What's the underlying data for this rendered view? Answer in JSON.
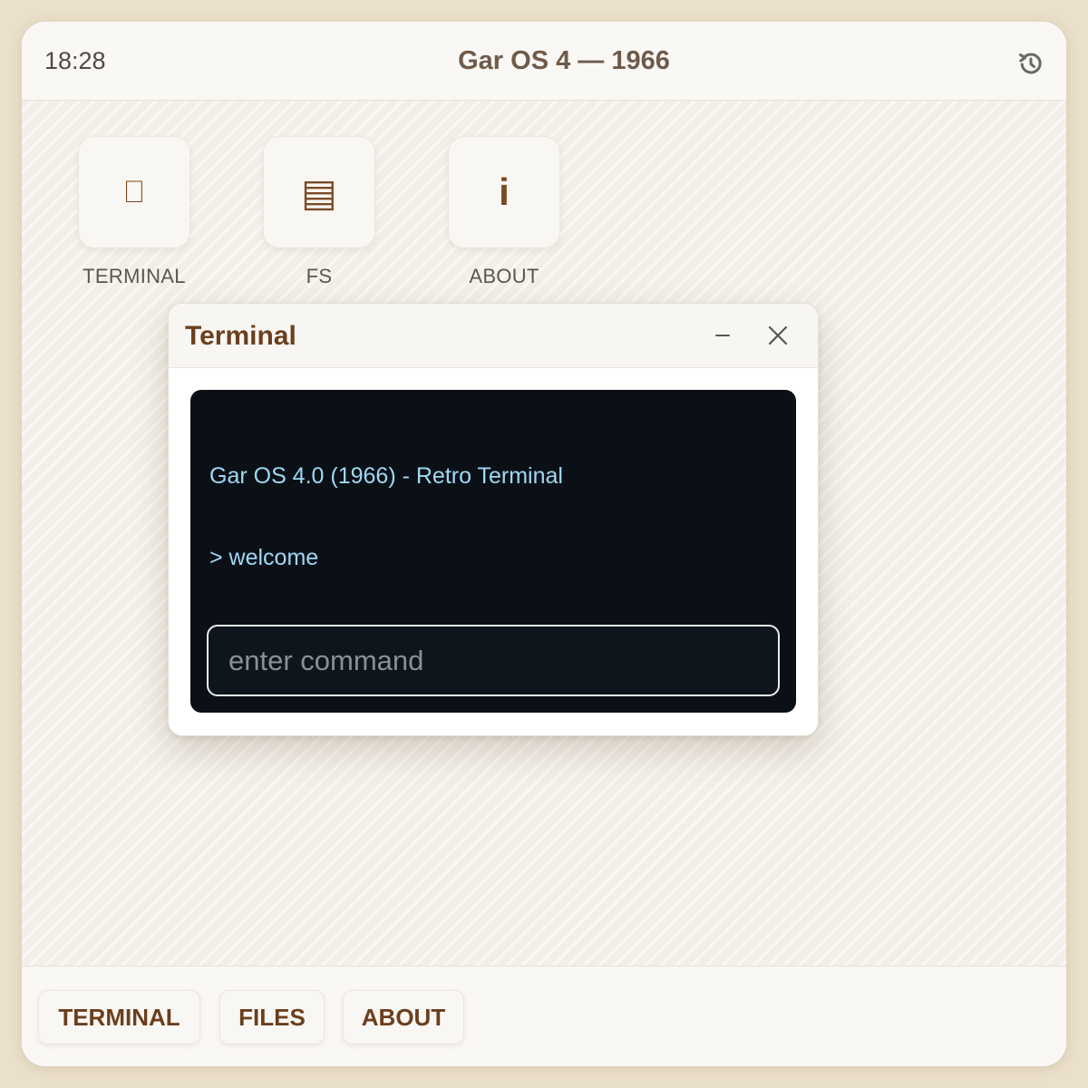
{
  "topbar": {
    "time": "18:28",
    "title": "Gar OS 4 — 1966",
    "restart_icon": "restart-icon"
  },
  "desktop_icons": [
    {
      "glyph": "⎕",
      "icon": "terminal-icon",
      "label": "TERMINAL"
    },
    {
      "glyph": "▤",
      "icon": "folder-icon",
      "label": "FS"
    },
    {
      "glyph": "i",
      "icon": "info-icon",
      "label": "ABOUT"
    }
  ],
  "window": {
    "title": "Terminal",
    "minimize_icon": "minimize-icon",
    "close_icon": "close-icon"
  },
  "terminal": {
    "lines": [
      "Gar OS 4.0 (1966) - Retro Terminal",
      "> welcome"
    ],
    "input_value": "",
    "input_placeholder": "enter command"
  },
  "taskbar": {
    "buttons": [
      "TERMINAL",
      "FILES",
      "ABOUT"
    ]
  },
  "colors": {
    "accent": "#6b3f1d",
    "terminal_bg": "#0b1016",
    "terminal_text": "#9fd8f4"
  }
}
